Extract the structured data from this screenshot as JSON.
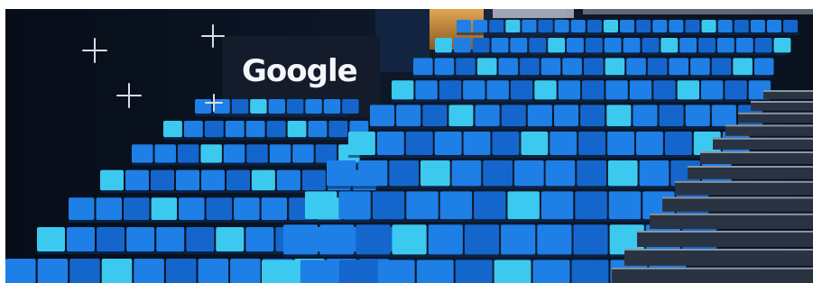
{
  "photo": {
    "subject": "auditorium",
    "wall_sign": {
      "logo_text": "Google"
    },
    "colors": {
      "wall_dark": "#0b1424",
      "sign_panel": "#141c2b",
      "seat_blue": "#1e7fe6",
      "seat_cyan": "#3cc9f0",
      "seat_deep": "#1466cc",
      "stairs": "#2a3342",
      "stair_nosing": "#8a96a6",
      "window_wood": "#c98a3a"
    },
    "icons": [
      "plus-decoration-icon"
    ]
  }
}
